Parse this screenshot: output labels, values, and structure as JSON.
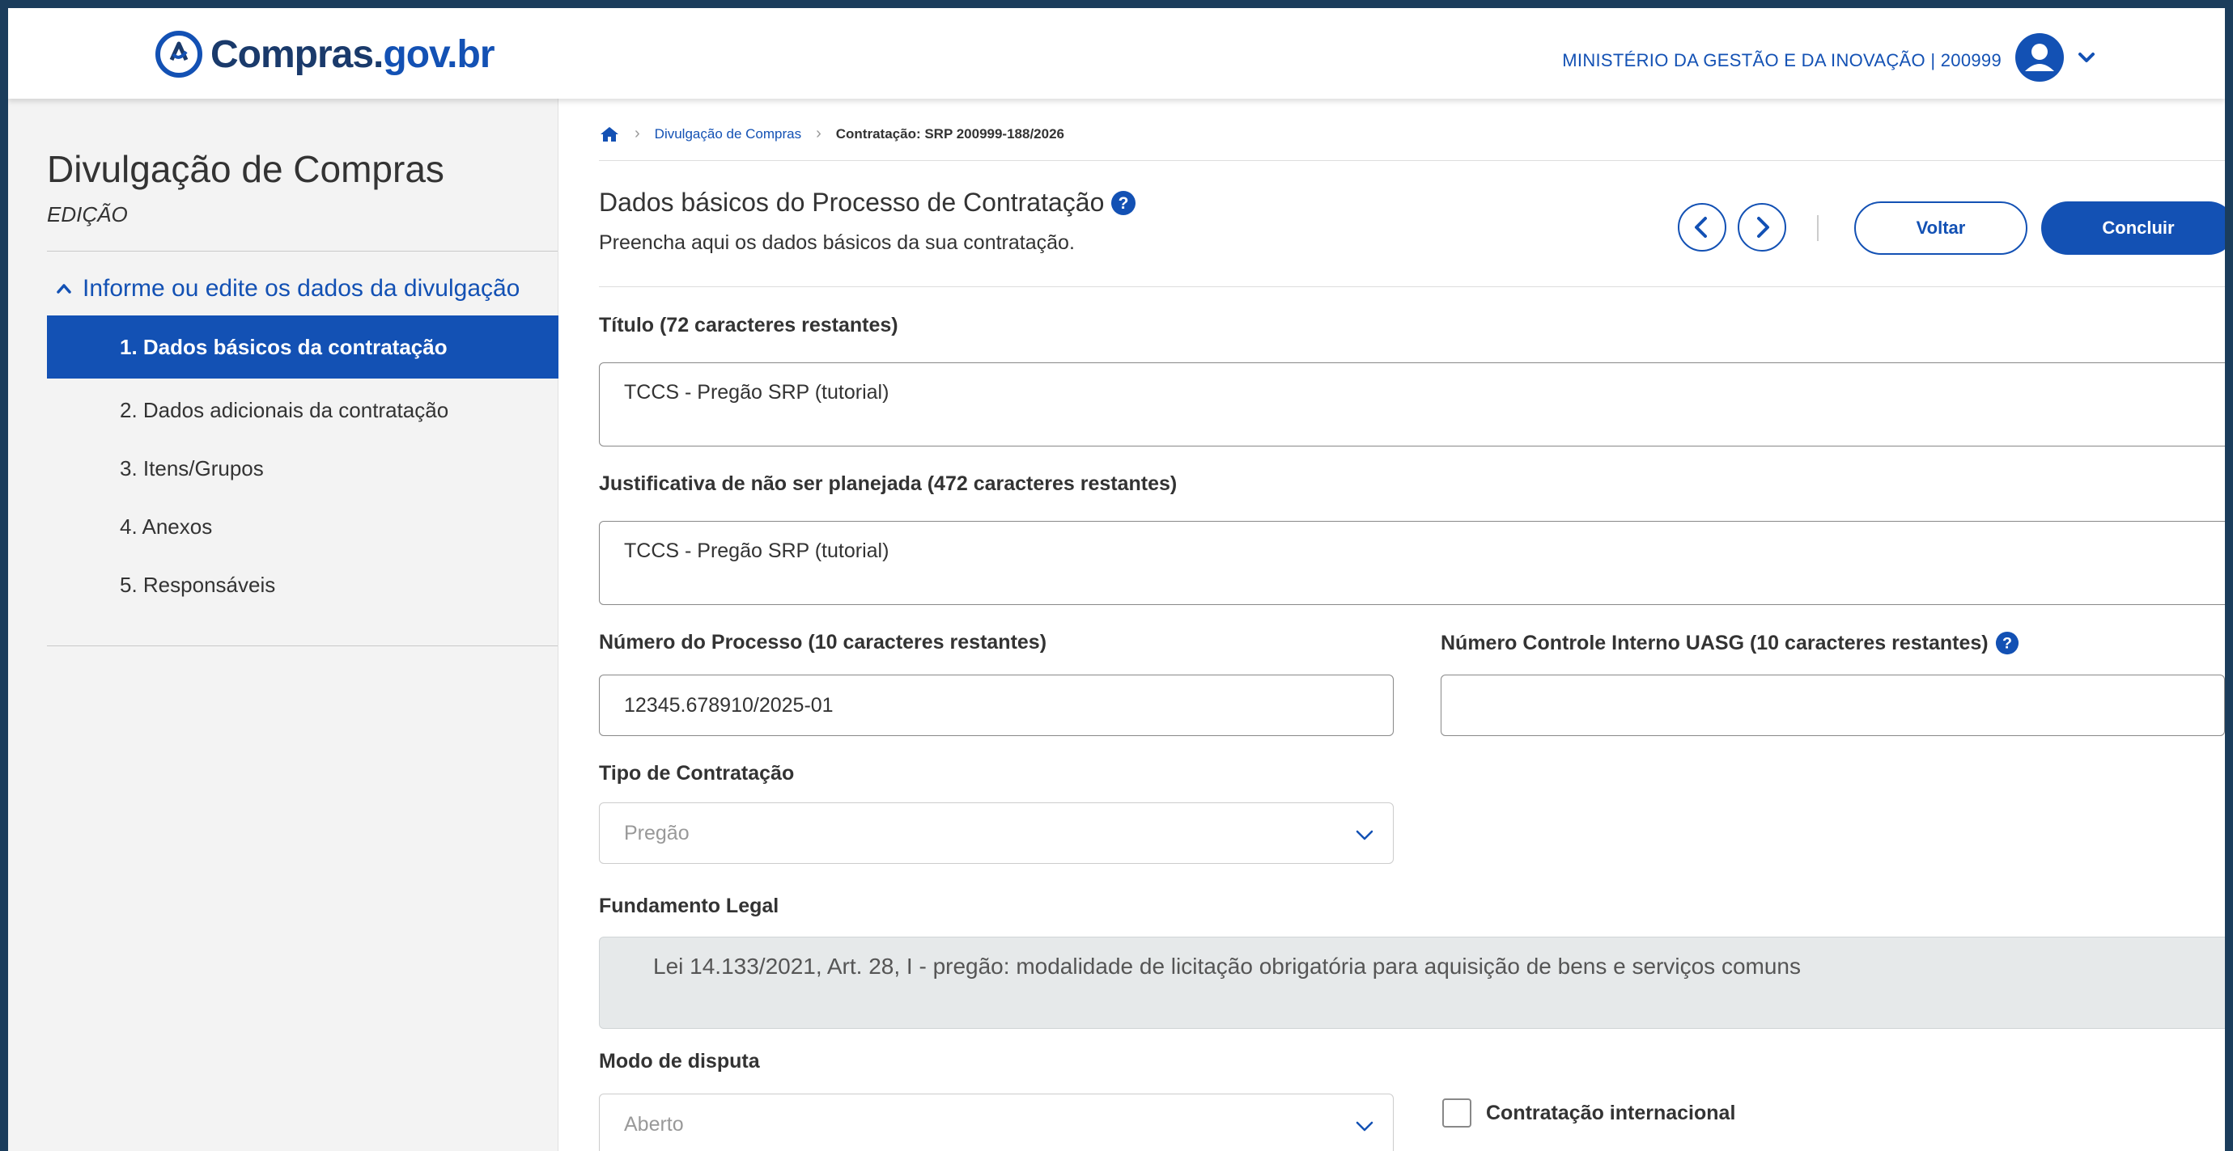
{
  "header": {
    "logo_part1": "Compras.",
    "logo_part2": "gov.br",
    "org_text": "MINISTÉRIO DA GESTÃO E DA INOVAÇÃO | 200999",
    "user_icon": "user-circle-icon",
    "caret_icon": "chevron-down-icon"
  },
  "sidebar": {
    "title": "Divulgação de Compras",
    "subtitle": "EDIÇÃO",
    "section_label": "Informe ou edite os dados da divulgação",
    "items": [
      {
        "label": "1. Dados básicos da contratação",
        "active": true
      },
      {
        "label": "2. Dados adicionais da contratação",
        "active": false
      },
      {
        "label": "3. Itens/Grupos",
        "active": false
      },
      {
        "label": "4. Anexos",
        "active": false
      },
      {
        "label": "5. Responsáveis",
        "active": false
      }
    ]
  },
  "breadcrumb": {
    "home_icon": "home-icon",
    "items": [
      "Divulgação de Compras",
      "Contratação: SRP 200999-188/2026"
    ]
  },
  "page": {
    "title": "Dados básicos do Processo de Contratação",
    "description": "Preencha aqui os dados básicos da sua contratação.",
    "voltar_label": "Voltar",
    "concluir_label": "Concluir"
  },
  "form": {
    "titulo_label": "Título (72 caracteres restantes)",
    "titulo_value": "TCCS - Pregão SRP (tutorial)",
    "justificativa_label": "Justificativa de não ser planejada (472 caracteres restantes)",
    "justificativa_value": "TCCS - Pregão SRP (tutorial)",
    "numero_processo_label": "Número do Processo (10 caracteres restantes)",
    "numero_processo_value": "12345.678910/2025-01",
    "controle_interno_label": "Número Controle Interno UASG (10 caracteres restantes)",
    "controle_interno_value": "",
    "tipo_label": "Tipo de Contratação",
    "tipo_value": "Pregão",
    "fundamento_label": "Fundamento Legal",
    "fundamento_value": "Lei 14.133/2021, Art. 28, I - pregão: modalidade de licitação obrigatória para aquisição de bens e serviços comuns",
    "modo_label": "Modo de disputa",
    "modo_value": "Aberto",
    "internacional_label": "Contratação internacional",
    "internacional_checked": false
  },
  "colors": {
    "primary": "#1351b4",
    "frame": "#1b3d5c",
    "sidebar_bg": "#f3f3f3",
    "readonly_bg": "#e6e9ea"
  }
}
